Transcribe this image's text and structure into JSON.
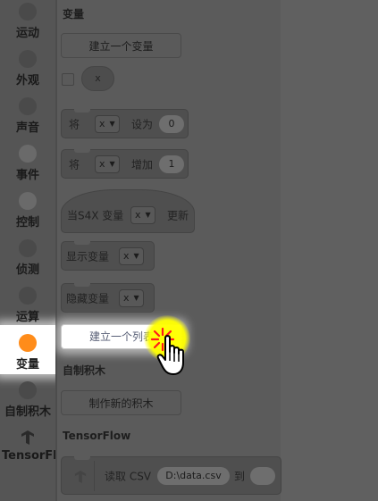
{
  "sidebar": {
    "categories": [
      {
        "label": "运动",
        "color": "#4a4a4a"
      },
      {
        "label": "外观",
        "color": "#4a4a4a"
      },
      {
        "label": "声音",
        "color": "#4a4a4a"
      },
      {
        "label": "事件",
        "color": "#6a6a6a"
      },
      {
        "label": "控制",
        "color": "#6a6a6a"
      },
      {
        "label": "侦测",
        "color": "#4a4a4a"
      },
      {
        "label": "运算",
        "color": "#4a4a4a"
      },
      {
        "label": "变量",
        "color": "#ff8c1a",
        "selected": true
      },
      {
        "label": "自制积木",
        "color": "#4a4a4a"
      },
      {
        "label": "TensorFlow",
        "icon": "tensorflow-icon"
      }
    ]
  },
  "palette": {
    "variables_heading": "变量",
    "make_variable_button": "建立一个变量",
    "variable_reporter": "x",
    "blocks": {
      "set": {
        "text": "将",
        "dropdown": "x",
        "mid": "设为",
        "value": "0"
      },
      "change": {
        "text": "将",
        "dropdown": "x",
        "mid": "增加",
        "value": "1"
      },
      "when_s4x": {
        "text": "当S4X 变量",
        "dropdown": "x",
        "end": "更新"
      },
      "show": {
        "text": "显示变量",
        "dropdown": "x"
      },
      "hide": {
        "text": "隐藏变量",
        "dropdown": "x"
      }
    },
    "make_list_button": "建立一个列表",
    "my_blocks_heading": "自制积木",
    "make_block_button": "制作新的积木",
    "tensorflow_heading": "TensorFlow",
    "read_csv": {
      "text": "读取 CSV",
      "path": "D:\\data.csv",
      "to": "到"
    }
  },
  "cursor": {
    "icon": "hand-pointer-icon",
    "highlight_color": "#ffff00",
    "click_color": "#ff0000"
  },
  "colors": {
    "variables": "#ff8c1a",
    "sidebar_bg": "#555555",
    "palette_bg": "#5b5b5b"
  }
}
